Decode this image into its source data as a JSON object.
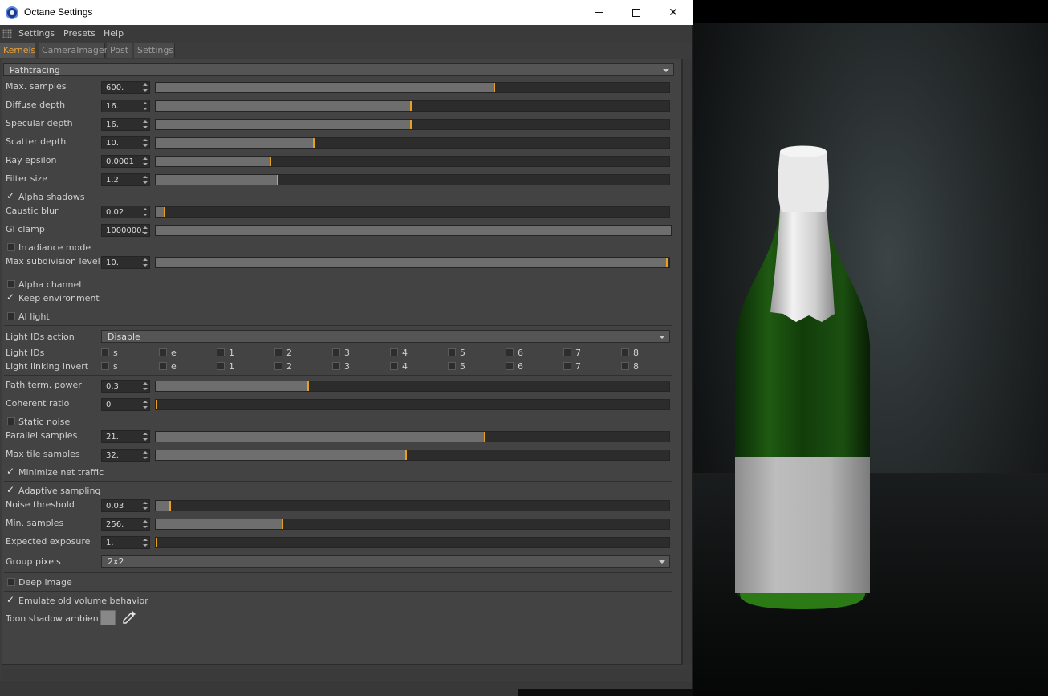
{
  "window": {
    "title": "Octane Settings",
    "minimize_glyph": "",
    "close_glyph": "✕"
  },
  "menu": [
    "Settings",
    "Presets",
    "Help"
  ],
  "tabs": [
    {
      "label": "Kernels",
      "active": true
    },
    {
      "label": "CameraImager",
      "active": false
    },
    {
      "label": "Post",
      "active": false
    },
    {
      "label": "Settings",
      "active": false
    }
  ],
  "kernel": {
    "selected": "Pathtracing"
  },
  "params": {
    "max_samples": {
      "label": "Max. samples",
      "value": "600.",
      "fraction": 0.66
    },
    "diffuse_depth": {
      "label": "Diffuse depth",
      "value": "16.",
      "fraction": 0.497
    },
    "specular_depth": {
      "label": "Specular depth",
      "value": "16.",
      "fraction": 0.497
    },
    "scatter_depth": {
      "label": "Scatter depth",
      "value": "10.",
      "fraction": 0.308
    },
    "ray_epsilon": {
      "label": "Ray epsilon",
      "value": "0.0001",
      "fraction": 0.223
    },
    "filter_size": {
      "label": "Filter size",
      "value": "1.2",
      "fraction": 0.237
    },
    "alpha_shadows": {
      "label": "Alpha shadows",
      "checked": true
    },
    "caustic_blur": {
      "label": "Caustic blur",
      "value": "0.02",
      "fraction": 0.017
    },
    "gi_clamp": {
      "label": "GI clamp",
      "value": "1000000.",
      "fraction": 1.0
    },
    "irradiance_mode": {
      "label": "Irradiance mode",
      "checked": false
    },
    "max_subdivision": {
      "label": "Max subdivision level",
      "value": "10.",
      "fraction": 0.996
    },
    "alpha_channel": {
      "label": "Alpha channel",
      "checked": false
    },
    "keep_environment": {
      "label": "Keep environment",
      "checked": true
    },
    "ai_light": {
      "label": "AI light",
      "checked": false
    },
    "light_ids_action": {
      "label": "Light IDs action",
      "value": "Disable"
    },
    "light_ids": {
      "label": "Light IDs",
      "items": [
        "s",
        "e",
        "1",
        "2",
        "3",
        "4",
        "5",
        "6",
        "7",
        "8"
      ]
    },
    "light_linking_invert": {
      "label": "Light linking invert",
      "items": [
        "s",
        "e",
        "1",
        "2",
        "3",
        "4",
        "5",
        "6",
        "7",
        "8"
      ]
    },
    "path_term_power": {
      "label": "Path term. power",
      "value": "0.3",
      "fraction": 0.297
    },
    "coherent_ratio": {
      "label": "Coherent ratio",
      "value": "0",
      "fraction": 0.0
    },
    "static_noise": {
      "label": "Static noise",
      "checked": false
    },
    "parallel_samples": {
      "label": "Parallel samples",
      "value": "21.",
      "fraction": 0.64
    },
    "max_tile_samples": {
      "label": "Max tile samples",
      "value": "32.",
      "fraction": 0.488
    },
    "minimize_net_traffic": {
      "label": "Minimize net traffic",
      "checked": true
    },
    "adaptive_sampling": {
      "label": "Adaptive sampling",
      "checked": true
    },
    "noise_threshold": {
      "label": "Noise threshold",
      "value": "0.03",
      "fraction": 0.028
    },
    "min_samples": {
      "label": "Min. samples",
      "value": "256.",
      "fraction": 0.247
    },
    "expected_exposure": {
      "label": "Expected exposure",
      "value": "1.",
      "fraction": 0.0
    },
    "group_pixels": {
      "label": "Group pixels",
      "value": "2x2"
    },
    "deep_image": {
      "label": "Deep image",
      "checked": false
    },
    "emulate_old_volume": {
      "label": "Emulate old volume behavior",
      "checked": true
    },
    "toon_shadow_ambient": {
      "label": "Toon shadow ambient",
      "color": "#888888"
    }
  },
  "colors": {
    "accent": "#e8a021",
    "panel": "#434343"
  },
  "render": {
    "subject": "champagne-bottle"
  }
}
